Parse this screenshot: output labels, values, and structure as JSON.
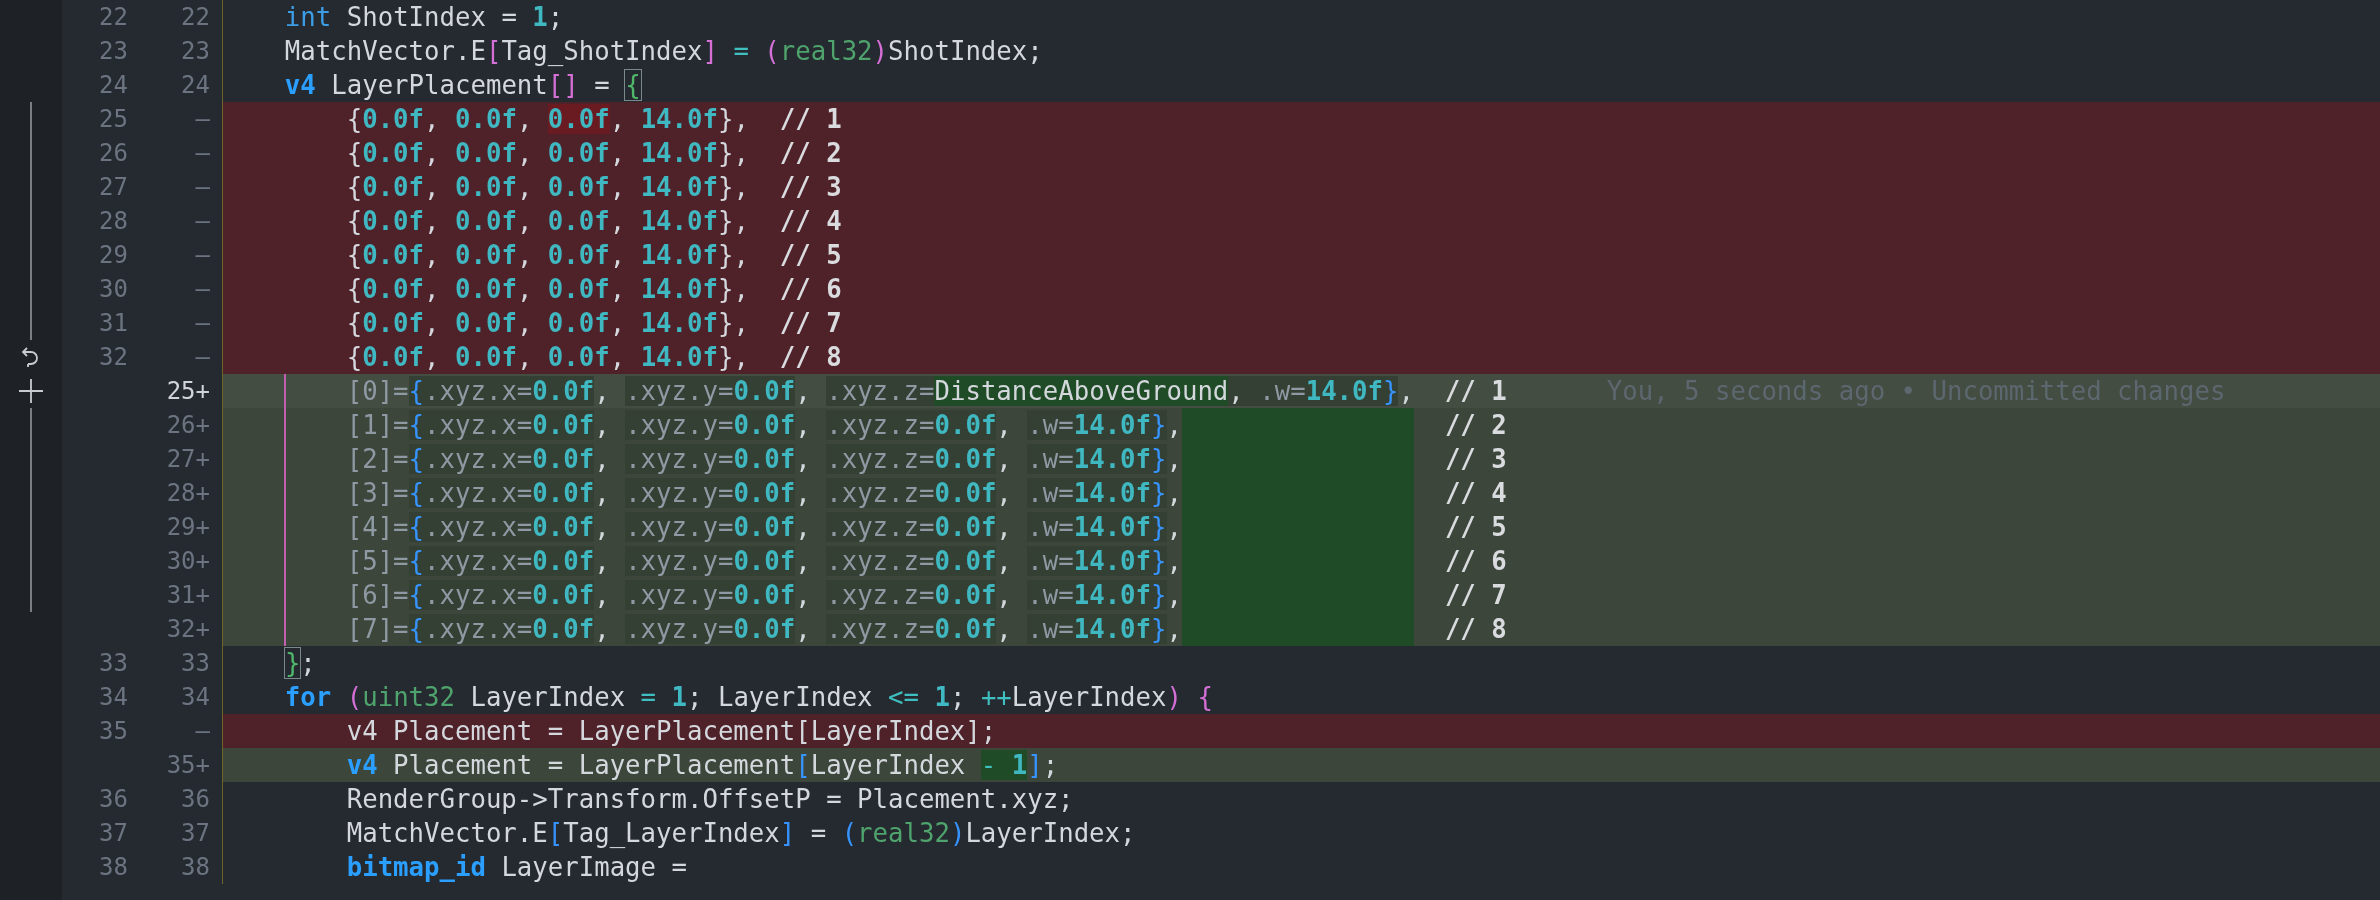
{
  "lines": [
    {
      "kind": "context",
      "old": "22",
      "new": "22",
      "guide": false,
      "tokens": [
        {
          "text": "    int",
          "kind": "kw"
        },
        {
          "text": " ShotIndex = ",
          "kind": "id"
        },
        {
          "text": "1",
          "kind": "num"
        },
        {
          "text": ";",
          "kind": "id"
        }
      ]
    },
    {
      "kind": "context",
      "old": "23",
      "new": "23",
      "guide": false,
      "tokens": [
        {
          "text": "    MatchVector.E",
          "kind": "id"
        },
        {
          "text": "[",
          "kind": "br2"
        },
        {
          "text": "Tag_ShotIndex",
          "kind": "id"
        },
        {
          "text": "]",
          "kind": "br2"
        },
        {
          "text": " = ",
          "kind": "op"
        },
        {
          "text": "(",
          "kind": "br2"
        },
        {
          "text": "real32",
          "kind": "type"
        },
        {
          "text": ")",
          "kind": "br2"
        },
        {
          "text": "ShotIndex;",
          "kind": "id"
        }
      ]
    },
    {
      "kind": "context",
      "old": "24",
      "new": "24",
      "guide": false,
      "tokens": [
        {
          "text": "    v4",
          "kind": "kwb"
        },
        {
          "text": " LayerPlacement",
          "kind": "id"
        },
        {
          "text": "[]",
          "kind": "br2"
        },
        {
          "text": " = ",
          "kind": "id"
        },
        {
          "text": "{",
          "kind": "br3",
          "highlight": {
            "kind": "box"
          }
        }
      ]
    },
    {
      "kind": "removed",
      "gutter": {
        "kind": "bar"
      },
      "old": "25",
      "new": "—",
      "guide": false,
      "tokens": [
        {
          "text": "        {",
          "kind": "id"
        },
        {
          "text": "0.0f",
          "kind": "num"
        },
        {
          "text": ", ",
          "kind": "id"
        },
        {
          "text": "0.0f",
          "kind": "num"
        },
        {
          "text": ", ",
          "kind": "id"
        },
        {
          "text": "0.0f",
          "kind": "num",
          "highlight": {
            "kind": "del"
          }
        },
        {
          "text": ", ",
          "kind": "id"
        },
        {
          "text": "14.0f",
          "kind": "num"
        },
        {
          "text": "},",
          "kind": "id"
        },
        {
          "text": "  // 1",
          "kind": "cm"
        }
      ]
    },
    {
      "kind": "removed",
      "gutter": {
        "kind": "bar"
      },
      "old": "26",
      "new": "—",
      "guide": false,
      "tokens": [
        {
          "text": "        {",
          "kind": "id"
        },
        {
          "text": "0.0f",
          "kind": "num"
        },
        {
          "text": ", ",
          "kind": "id"
        },
        {
          "text": "0.0f",
          "kind": "num"
        },
        {
          "text": ", ",
          "kind": "id"
        },
        {
          "text": "0.0f",
          "kind": "num"
        },
        {
          "text": ", ",
          "kind": "id"
        },
        {
          "text": "14.0f",
          "kind": "num"
        },
        {
          "text": "},",
          "kind": "id"
        },
        {
          "text": "  // 2",
          "kind": "cm"
        }
      ]
    },
    {
      "kind": "removed",
      "gutter": {
        "kind": "bar"
      },
      "old": "27",
      "new": "—",
      "guide": false,
      "tokens": [
        {
          "text": "        {",
          "kind": "id"
        },
        {
          "text": "0.0f",
          "kind": "num"
        },
        {
          "text": ", ",
          "kind": "id"
        },
        {
          "text": "0.0f",
          "kind": "num"
        },
        {
          "text": ", ",
          "kind": "id"
        },
        {
          "text": "0.0f",
          "kind": "num"
        },
        {
          "text": ", ",
          "kind": "id"
        },
        {
          "text": "14.0f",
          "kind": "num"
        },
        {
          "text": "},",
          "kind": "id"
        },
        {
          "text": "  // 3",
          "kind": "cm"
        }
      ]
    },
    {
      "kind": "removed",
      "gutter": {
        "kind": "bar"
      },
      "old": "28",
      "new": "—",
      "guide": false,
      "tokens": [
        {
          "text": "        {",
          "kind": "id"
        },
        {
          "text": "0.0f",
          "kind": "num"
        },
        {
          "text": ", ",
          "kind": "id"
        },
        {
          "text": "0.0f",
          "kind": "num"
        },
        {
          "text": ", ",
          "kind": "id"
        },
        {
          "text": "0.0f",
          "kind": "num"
        },
        {
          "text": ", ",
          "kind": "id"
        },
        {
          "text": "14.0f",
          "kind": "num"
        },
        {
          "text": "},",
          "kind": "id"
        },
        {
          "text": "  // 4",
          "kind": "cm"
        }
      ]
    },
    {
      "kind": "removed",
      "gutter": {
        "kind": "bar"
      },
      "old": "29",
      "new": "—",
      "guide": false,
      "tokens": [
        {
          "text": "        {",
          "kind": "id"
        },
        {
          "text": "0.0f",
          "kind": "num"
        },
        {
          "text": ", ",
          "kind": "id"
        },
        {
          "text": "0.0f",
          "kind": "num"
        },
        {
          "text": ", ",
          "kind": "id"
        },
        {
          "text": "0.0f",
          "kind": "num"
        },
        {
          "text": ", ",
          "kind": "id"
        },
        {
          "text": "14.0f",
          "kind": "num"
        },
        {
          "text": "},",
          "kind": "id"
        },
        {
          "text": "  // 5",
          "kind": "cm"
        }
      ]
    },
    {
      "kind": "removed",
      "gutter": {
        "kind": "bar"
      },
      "old": "30",
      "new": "—",
      "guide": false,
      "tokens": [
        {
          "text": "        {",
          "kind": "id"
        },
        {
          "text": "0.0f",
          "kind": "num"
        },
        {
          "text": ", ",
          "kind": "id"
        },
        {
          "text": "0.0f",
          "kind": "num"
        },
        {
          "text": ", ",
          "kind": "id"
        },
        {
          "text": "0.0f",
          "kind": "num"
        },
        {
          "text": ", ",
          "kind": "id"
        },
        {
          "text": "14.0f",
          "kind": "num"
        },
        {
          "text": "},",
          "kind": "id"
        },
        {
          "text": "  // 6",
          "kind": "cm"
        }
      ]
    },
    {
      "kind": "removed",
      "gutter": {
        "kind": "bar"
      },
      "old": "31",
      "new": "—",
      "guide": false,
      "tokens": [
        {
          "text": "        {",
          "kind": "id"
        },
        {
          "text": "0.0f",
          "kind": "num"
        },
        {
          "text": ", ",
          "kind": "id"
        },
        {
          "text": "0.0f",
          "kind": "num"
        },
        {
          "text": ", ",
          "kind": "id"
        },
        {
          "text": "0.0f",
          "kind": "num"
        },
        {
          "text": ", ",
          "kind": "id"
        },
        {
          "text": "14.0f",
          "kind": "num"
        },
        {
          "text": "},",
          "kind": "id"
        },
        {
          "text": "  // 7",
          "kind": "cm"
        }
      ]
    },
    {
      "kind": "removed",
      "gutter": {
        "kind": "revert"
      },
      "old": "32",
      "new": "—",
      "guide": false,
      "tokens": [
        {
          "text": "        {",
          "kind": "id"
        },
        {
          "text": "0.0f",
          "kind": "num"
        },
        {
          "text": ", ",
          "kind": "id"
        },
        {
          "text": "0.0f",
          "kind": "num"
        },
        {
          "text": ", ",
          "kind": "id"
        },
        {
          "text": "0.0f",
          "kind": "num"
        },
        {
          "text": ", ",
          "kind": "id"
        },
        {
          "text": "14.0f",
          "kind": "num"
        },
        {
          "text": "},",
          "kind": "id"
        },
        {
          "text": "  // 8",
          "kind": "cm"
        }
      ]
    },
    {
      "kind": "current",
      "gutter": {
        "kind": "add"
      },
      "new": "25+",
      "guide": true,
      "blame": "You, 5 seconds ago • Uncommitted changes",
      "tokens": [
        {
          "text": "        [0]=",
          "kind": "dim"
        },
        {
          "text": "{",
          "kind": "br1",
          "highlight": {
            "kind": "dim"
          }
        },
        {
          "text": ".xyz.x=",
          "kind": "dim",
          "highlight": {
            "kind": "dim"
          }
        },
        {
          "text": "0.0f",
          "kind": "num",
          "highlight": {
            "kind": "dim"
          }
        },
        {
          "text": ", ",
          "kind": "id"
        },
        {
          "text": ".xyz.y=",
          "kind": "dim",
          "highlight": {
            "kind": "dim"
          }
        },
        {
          "text": "0.0f",
          "kind": "num",
          "highlight": {
            "kind": "dim"
          }
        },
        {
          "text": ", ",
          "kind": "id"
        },
        {
          "text": ".xyz.z=",
          "kind": "dim",
          "highlight": {
            "kind": "dim"
          }
        },
        {
          "text": "DistanceAboveGround",
          "kind": "id",
          "highlight": {
            "kind": "strong"
          }
        },
        {
          "text": ", ",
          "kind": "id",
          "highlight": {
            "kind": "dim"
          }
        },
        {
          "text": ".w=",
          "kind": "dim",
          "highlight": {
            "kind": "dim"
          }
        },
        {
          "text": "14.0f",
          "kind": "num",
          "highlight": {
            "kind": "dim"
          }
        },
        {
          "text": "}",
          "kind": "br1",
          "highlight": {
            "kind": "dim"
          }
        },
        {
          "text": ",",
          "kind": "id"
        },
        {
          "text": "  // 1",
          "kind": "cm"
        }
      ]
    },
    {
      "kind": "added",
      "gutter": {
        "kind": "bar"
      },
      "new": "26+",
      "guide": true,
      "tokens": [
        {
          "text": "        [1]=",
          "kind": "dim"
        },
        {
          "text": "{",
          "kind": "br1",
          "highlight": {
            "kind": "dim"
          }
        },
        {
          "text": ".xyz.x=",
          "kind": "dim",
          "highlight": {
            "kind": "dim"
          }
        },
        {
          "text": "0.0f",
          "kind": "num",
          "highlight": {
            "kind": "dim"
          }
        },
        {
          "text": ", ",
          "kind": "id"
        },
        {
          "text": ".xyz.y=",
          "kind": "dim",
          "highlight": {
            "kind": "dim"
          }
        },
        {
          "text": "0.0f",
          "kind": "num",
          "highlight": {
            "kind": "dim"
          }
        },
        {
          "text": ", ",
          "kind": "id"
        },
        {
          "text": ".xyz.z=",
          "kind": "dim",
          "highlight": {
            "kind": "dim"
          }
        },
        {
          "text": "0.0f",
          "kind": "num",
          "highlight": {
            "kind": "dim"
          }
        },
        {
          "text": ", ",
          "kind": "id"
        },
        {
          "text": ".w=",
          "kind": "dim",
          "highlight": {
            "kind": "dim"
          }
        },
        {
          "text": "14.0f",
          "kind": "num",
          "highlight": {
            "kind": "dim"
          }
        },
        {
          "text": "}",
          "kind": "br1",
          "highlight": {
            "kind": "dim"
          }
        },
        {
          "text": ",",
          "kind": "id",
          "fill": true
        },
        {
          "text": "  // 2",
          "kind": "cm"
        }
      ]
    },
    {
      "kind": "added",
      "gutter": {
        "kind": "bar"
      },
      "new": "27+",
      "guide": true,
      "tokens": [
        {
          "text": "        [2]=",
          "kind": "dim"
        },
        {
          "text": "{",
          "kind": "br1",
          "highlight": {
            "kind": "dim"
          }
        },
        {
          "text": ".xyz.x=",
          "kind": "dim",
          "highlight": {
            "kind": "dim"
          }
        },
        {
          "text": "0.0f",
          "kind": "num",
          "highlight": {
            "kind": "dim"
          }
        },
        {
          "text": ", ",
          "kind": "id"
        },
        {
          "text": ".xyz.y=",
          "kind": "dim",
          "highlight": {
            "kind": "dim"
          }
        },
        {
          "text": "0.0f",
          "kind": "num",
          "highlight": {
            "kind": "dim"
          }
        },
        {
          "text": ", ",
          "kind": "id"
        },
        {
          "text": ".xyz.z=",
          "kind": "dim",
          "highlight": {
            "kind": "dim"
          }
        },
        {
          "text": "0.0f",
          "kind": "num",
          "highlight": {
            "kind": "dim"
          }
        },
        {
          "text": ", ",
          "kind": "id"
        },
        {
          "text": ".w=",
          "kind": "dim",
          "highlight": {
            "kind": "dim"
          }
        },
        {
          "text": "14.0f",
          "kind": "num",
          "highlight": {
            "kind": "dim"
          }
        },
        {
          "text": "}",
          "kind": "br1",
          "highlight": {
            "kind": "dim"
          }
        },
        {
          "text": ",",
          "kind": "id",
          "fill": true
        },
        {
          "text": "  // 3",
          "kind": "cm"
        }
      ]
    },
    {
      "kind": "added",
      "gutter": {
        "kind": "bar"
      },
      "new": "28+",
      "guide": true,
      "tokens": [
        {
          "text": "        [3]=",
          "kind": "dim"
        },
        {
          "text": "{",
          "kind": "br1",
          "highlight": {
            "kind": "dim"
          }
        },
        {
          "text": ".xyz.x=",
          "kind": "dim",
          "highlight": {
            "kind": "dim"
          }
        },
        {
          "text": "0.0f",
          "kind": "num",
          "highlight": {
            "kind": "dim"
          }
        },
        {
          "text": ", ",
          "kind": "id"
        },
        {
          "text": ".xyz.y=",
          "kind": "dim",
          "highlight": {
            "kind": "dim"
          }
        },
        {
          "text": "0.0f",
          "kind": "num",
          "highlight": {
            "kind": "dim"
          }
        },
        {
          "text": ", ",
          "kind": "id"
        },
        {
          "text": ".xyz.z=",
          "kind": "dim",
          "highlight": {
            "kind": "dim"
          }
        },
        {
          "text": "0.0f",
          "kind": "num",
          "highlight": {
            "kind": "dim"
          }
        },
        {
          "text": ", ",
          "kind": "id"
        },
        {
          "text": ".w=",
          "kind": "dim",
          "highlight": {
            "kind": "dim"
          }
        },
        {
          "text": "14.0f",
          "kind": "num",
          "highlight": {
            "kind": "dim"
          }
        },
        {
          "text": "}",
          "kind": "br1",
          "highlight": {
            "kind": "dim"
          }
        },
        {
          "text": ",",
          "kind": "id",
          "fill": true
        },
        {
          "text": "  // 4",
          "kind": "cm"
        }
      ]
    },
    {
      "kind": "added",
      "gutter": {
        "kind": "bar"
      },
      "new": "29+",
      "guide": true,
      "tokens": [
        {
          "text": "        [4]=",
          "kind": "dim"
        },
        {
          "text": "{",
          "kind": "br1",
          "highlight": {
            "kind": "dim"
          }
        },
        {
          "text": ".xyz.x=",
          "kind": "dim",
          "highlight": {
            "kind": "dim"
          }
        },
        {
          "text": "0.0f",
          "kind": "num",
          "highlight": {
            "kind": "dim"
          }
        },
        {
          "text": ", ",
          "kind": "id"
        },
        {
          "text": ".xyz.y=",
          "kind": "dim",
          "highlight": {
            "kind": "dim"
          }
        },
        {
          "text": "0.0f",
          "kind": "num",
          "highlight": {
            "kind": "dim"
          }
        },
        {
          "text": ", ",
          "kind": "id"
        },
        {
          "text": ".xyz.z=",
          "kind": "dim",
          "highlight": {
            "kind": "dim"
          }
        },
        {
          "text": "0.0f",
          "kind": "num",
          "highlight": {
            "kind": "dim"
          }
        },
        {
          "text": ", ",
          "kind": "id"
        },
        {
          "text": ".w=",
          "kind": "dim",
          "highlight": {
            "kind": "dim"
          }
        },
        {
          "text": "14.0f",
          "kind": "num",
          "highlight": {
            "kind": "dim"
          }
        },
        {
          "text": "}",
          "kind": "br1",
          "highlight": {
            "kind": "dim"
          }
        },
        {
          "text": ",",
          "kind": "id",
          "fill": true
        },
        {
          "text": "  // 5",
          "kind": "cm"
        }
      ]
    },
    {
      "kind": "added",
      "gutter": {
        "kind": "bar"
      },
      "new": "30+",
      "guide": true,
      "tokens": [
        {
          "text": "        [5]=",
          "kind": "dim"
        },
        {
          "text": "{",
          "kind": "br1",
          "highlight": {
            "kind": "dim"
          }
        },
        {
          "text": ".xyz.x=",
          "kind": "dim",
          "highlight": {
            "kind": "dim"
          }
        },
        {
          "text": "0.0f",
          "kind": "num",
          "highlight": {
            "kind": "dim"
          }
        },
        {
          "text": ", ",
          "kind": "id"
        },
        {
          "text": ".xyz.y=",
          "kind": "dim",
          "highlight": {
            "kind": "dim"
          }
        },
        {
          "text": "0.0f",
          "kind": "num",
          "highlight": {
            "kind": "dim"
          }
        },
        {
          "text": ", ",
          "kind": "id"
        },
        {
          "text": ".xyz.z=",
          "kind": "dim",
          "highlight": {
            "kind": "dim"
          }
        },
        {
          "text": "0.0f",
          "kind": "num",
          "highlight": {
            "kind": "dim"
          }
        },
        {
          "text": ", ",
          "kind": "id"
        },
        {
          "text": ".w=",
          "kind": "dim",
          "highlight": {
            "kind": "dim"
          }
        },
        {
          "text": "14.0f",
          "kind": "num",
          "highlight": {
            "kind": "dim"
          }
        },
        {
          "text": "}",
          "kind": "br1",
          "highlight": {
            "kind": "dim"
          }
        },
        {
          "text": ",",
          "kind": "id",
          "fill": true
        },
        {
          "text": "  // 6",
          "kind": "cm"
        }
      ]
    },
    {
      "kind": "added",
      "gutter": {
        "kind": "bar"
      },
      "new": "31+",
      "guide": true,
      "tokens": [
        {
          "text": "        [6]=",
          "kind": "dim"
        },
        {
          "text": "{",
          "kind": "br1",
          "highlight": {
            "kind": "dim"
          }
        },
        {
          "text": ".xyz.x=",
          "kind": "dim",
          "highlight": {
            "kind": "dim"
          }
        },
        {
          "text": "0.0f",
          "kind": "num",
          "highlight": {
            "kind": "dim"
          }
        },
        {
          "text": ", ",
          "kind": "id"
        },
        {
          "text": ".xyz.y=",
          "kind": "dim",
          "highlight": {
            "kind": "dim"
          }
        },
        {
          "text": "0.0f",
          "kind": "num",
          "highlight": {
            "kind": "dim"
          }
        },
        {
          "text": ", ",
          "kind": "id"
        },
        {
          "text": ".xyz.z=",
          "kind": "dim",
          "highlight": {
            "kind": "dim"
          }
        },
        {
          "text": "0.0f",
          "kind": "num",
          "highlight": {
            "kind": "dim"
          }
        },
        {
          "text": ", ",
          "kind": "id"
        },
        {
          "text": ".w=",
          "kind": "dim",
          "highlight": {
            "kind": "dim"
          }
        },
        {
          "text": "14.0f",
          "kind": "num",
          "highlight": {
            "kind": "dim"
          }
        },
        {
          "text": "}",
          "kind": "br1",
          "highlight": {
            "kind": "dim"
          }
        },
        {
          "text": ",",
          "kind": "id",
          "fill": true
        },
        {
          "text": "  // 7",
          "kind": "cm"
        }
      ]
    },
    {
      "kind": "added",
      "new": "32+",
      "guide": true,
      "tokens": [
        {
          "text": "        [7]=",
          "kind": "dim"
        },
        {
          "text": "{",
          "kind": "br1",
          "highlight": {
            "kind": "dim"
          }
        },
        {
          "text": ".xyz.x=",
          "kind": "dim",
          "highlight": {
            "kind": "dim"
          }
        },
        {
          "text": "0.0f",
          "kind": "num",
          "highlight": {
            "kind": "dim"
          }
        },
        {
          "text": ", ",
          "kind": "id"
        },
        {
          "text": ".xyz.y=",
          "kind": "dim",
          "highlight": {
            "kind": "dim"
          }
        },
        {
          "text": "0.0f",
          "kind": "num",
          "highlight": {
            "kind": "dim"
          }
        },
        {
          "text": ", ",
          "kind": "id"
        },
        {
          "text": ".xyz.z=",
          "kind": "dim",
          "highlight": {
            "kind": "dim"
          }
        },
        {
          "text": "0.0f",
          "kind": "num",
          "highlight": {
            "kind": "dim"
          }
        },
        {
          "text": ", ",
          "kind": "id"
        },
        {
          "text": ".w=",
          "kind": "dim",
          "highlight": {
            "kind": "dim"
          }
        },
        {
          "text": "14.0f",
          "kind": "num",
          "highlight": {
            "kind": "dim"
          }
        },
        {
          "text": "}",
          "kind": "br1",
          "highlight": {
            "kind": "dim"
          }
        },
        {
          "text": ",",
          "kind": "id",
          "fill": true
        },
        {
          "text": "  // 8",
          "kind": "cm"
        }
      ]
    },
    {
      "kind": "context",
      "old": "33",
      "new": "33",
      "guide": false,
      "tokens": [
        {
          "text": "    }",
          "kind": "br3",
          "highlight": {
            "kind": "box"
          }
        },
        {
          "text": ";",
          "kind": "id"
        }
      ]
    },
    {
      "kind": "context",
      "old": "34",
      "new": "34",
      "guide": false,
      "tokens": [
        {
          "text": "    for",
          "kind": "kwb"
        },
        {
          "text": " (",
          "kind": "br2"
        },
        {
          "text": "uint32",
          "kind": "type"
        },
        {
          "text": " LayerIndex ",
          "kind": "id"
        },
        {
          "text": "= ",
          "kind": "op"
        },
        {
          "text": "1",
          "kind": "num"
        },
        {
          "text": "; LayerIndex ",
          "kind": "id"
        },
        {
          "text": "<= ",
          "kind": "op"
        },
        {
          "text": "1",
          "kind": "num"
        },
        {
          "text": "; ",
          "kind": "id"
        },
        {
          "text": "++",
          "kind": "op"
        },
        {
          "text": "LayerIndex",
          "kind": "id"
        },
        {
          "text": ")",
          "kind": "br2"
        },
        {
          "text": " {",
          "kind": "br2"
        }
      ]
    },
    {
      "kind": "removed",
      "old": "35",
      "new": "—",
      "guide": false,
      "tokens": [
        {
          "text": "        v4 Placement = LayerPlacement[LayerIndex];",
          "kind": "id"
        }
      ]
    },
    {
      "kind": "added",
      "new": "35+",
      "guide": false,
      "tokens": [
        {
          "text": "        v4",
          "kind": "kwb"
        },
        {
          "text": " Placement = LayerPlacement",
          "kind": "id"
        },
        {
          "text": "[",
          "kind": "br1"
        },
        {
          "text": "LayerIndex",
          "kind": "id"
        },
        {
          "text": " - ",
          "kind": "op",
          "highlight": {
            "kind": "strong"
          }
        },
        {
          "text": "1",
          "kind": "num",
          "highlight": {
            "kind": "strong"
          }
        },
        {
          "text": "]",
          "kind": "br1"
        },
        {
          "text": ";",
          "kind": "id"
        }
      ]
    },
    {
      "kind": "context",
      "old": "36",
      "new": "36",
      "guide": false,
      "tokens": [
        {
          "text": "        RenderGroup->Transform.OffsetP = Placement.xyz;",
          "kind": "id"
        }
      ]
    },
    {
      "kind": "context",
      "old": "37",
      "new": "37",
      "guide": false,
      "tokens": [
        {
          "text": "        MatchVector.E",
          "kind": "id"
        },
        {
          "text": "[",
          "kind": "br1"
        },
        {
          "text": "Tag_LayerIndex",
          "kind": "id"
        },
        {
          "text": "]",
          "kind": "br1"
        },
        {
          "text": " = ",
          "kind": "id"
        },
        {
          "text": "(",
          "kind": "br1"
        },
        {
          "text": "real32",
          "kind": "type"
        },
        {
          "text": ")",
          "kind": "br1"
        },
        {
          "text": "LayerIndex;",
          "kind": "id"
        }
      ]
    },
    {
      "kind": "context",
      "old": "38",
      "new": "38",
      "guide": false,
      "tokens": [
        {
          "text": "        bitmap_id",
          "kind": "kwb"
        },
        {
          "text": " LayerImage =",
          "kind": "id"
        }
      ]
    }
  ]
}
